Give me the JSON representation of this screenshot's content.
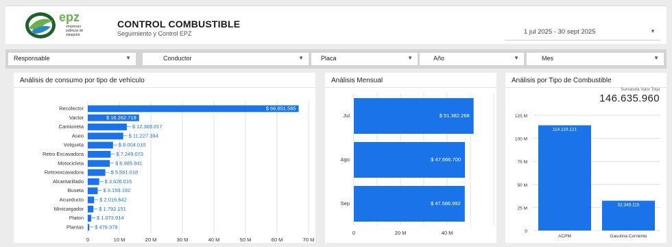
{
  "header": {
    "logo_text": "epz",
    "logo_subtext": [
      "empresas",
      "públicas de",
      "zipaquirá"
    ],
    "title": "CONTROL COMBUSTIBLE",
    "subtitle": "Seguimiento y Control EPZ",
    "date_range": "1 jul 2025 - 30 sept 2025"
  },
  "filters": [
    {
      "label": "Responsable"
    },
    {
      "label": "Conductor"
    },
    {
      "label": "Placa"
    },
    {
      "label": "Año"
    },
    {
      "label": "Mes"
    }
  ],
  "colors": {
    "bar": "#1a73e8",
    "label": "#1a73e8",
    "grid": "#e0e0e0",
    "filter_bar": "#d4d4d4"
  },
  "panels": {
    "vehiculo": {
      "title": "Análisis de consumo por tipo de vehículo"
    },
    "mensual": {
      "title": "Análisis Mensual"
    },
    "combustible": {
      "title": "Análisis por Tipo de Combustible",
      "total_label": "Sumatoria Valor Total",
      "total_value": "146.635.960"
    }
  },
  "chart_data": [
    {
      "type": "bar",
      "orientation": "horizontal",
      "title": "Análisis de consumo por tipo de vehículo",
      "categories": [
        "Recolector",
        "Vactor",
        "Camioneta",
        "Aseo",
        "Volqueta",
        "Retro Excavadora",
        "Motocicleta",
        "Retroexcavadora",
        "Alcantarillado",
        "Buseta",
        "Acueducto",
        "Minicargador",
        "Platon",
        "Plantas"
      ],
      "values": [
        66851595,
        16262719,
        12369017,
        11227394,
        8004010,
        7249073,
        6985841,
        5561018,
        3626015,
        3150192,
        2016642,
        1792151,
        1073914,
        476379
      ],
      "data_labels": [
        "$ 66.851.595",
        "$ 16.262.719",
        "$ 12.369.017",
        "$ 11.227.394",
        "$ 8.004.010",
        "$ 7.249.073",
        "$ 6.985.841",
        "$ 5.561.018",
        "$ 3.626.015",
        "$ 3.150.192",
        "$ 2.016.642",
        "$ 1.792.151",
        "$ 1.073.914",
        "$ 476.379"
      ],
      "x_ticks": [
        "0",
        "10 M",
        "20 M",
        "30 M",
        "40 M",
        "50 M",
        "60 M",
        "70 M"
      ],
      "xlim": [
        0,
        70000000
      ],
      "grid": true
    },
    {
      "type": "bar",
      "orientation": "horizontal",
      "title": "Análisis Mensual",
      "categories": [
        "Jul",
        "Ago",
        "Sep"
      ],
      "values": [
        51382268,
        47666700,
        47586992
      ],
      "data_labels": [
        "$ 51.382.268",
        "$ 47.666.700",
        "$ 47.586.992"
      ],
      "x_ticks": [
        "0",
        "20 M",
        "40 M"
      ],
      "xlim": [
        0,
        60000000
      ],
      "grid": true
    },
    {
      "type": "bar",
      "orientation": "vertical",
      "title": "Análisis por Tipo de Combustible",
      "categories": [
        "ACPM",
        "Gasolina Corriente"
      ],
      "values": [
        114119121,
        32349115
      ],
      "data_labels": [
        "114.119.121",
        "32.349.115"
      ],
      "y_ticks": [
        "0",
        "25 M",
        "50 M",
        "75 M",
        "100 M",
        "125 M"
      ],
      "ylim": [
        0,
        125000000
      ],
      "grid": true
    }
  ]
}
